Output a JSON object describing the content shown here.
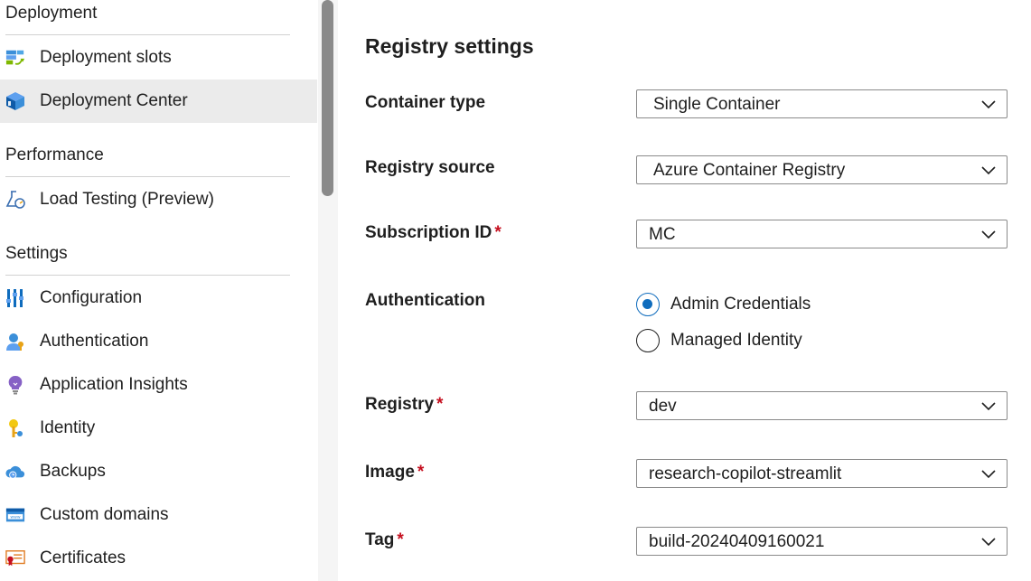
{
  "sidebar": {
    "sections": [
      {
        "title": "Deployment"
      },
      {
        "title": "Performance"
      },
      {
        "title": "Settings"
      }
    ],
    "items": [
      {
        "label": "Deployment slots",
        "icon": "deployment-slots-icon"
      },
      {
        "label": "Deployment Center",
        "icon": "deployment-center-icon",
        "selected": true
      },
      {
        "label": "Load Testing (Preview)",
        "icon": "load-testing-icon"
      },
      {
        "label": "Configuration",
        "icon": "configuration-icon"
      },
      {
        "label": "Authentication",
        "icon": "authentication-icon"
      },
      {
        "label": "Application Insights",
        "icon": "application-insights-icon"
      },
      {
        "label": "Identity",
        "icon": "identity-icon"
      },
      {
        "label": "Backups",
        "icon": "backups-icon"
      },
      {
        "label": "Custom domains",
        "icon": "custom-domains-icon"
      },
      {
        "label": "Certificates",
        "icon": "certificates-icon"
      }
    ]
  },
  "form": {
    "title": "Registry settings",
    "required_marker": "*",
    "container_type": {
      "label": "Container type",
      "value": "Single Container"
    },
    "registry_source": {
      "label": "Registry source",
      "value": "Azure Container Registry"
    },
    "subscription_id": {
      "label": "Subscription ID",
      "value": "MC"
    },
    "authentication": {
      "label": "Authentication",
      "options": [
        {
          "label": "Admin Credentials",
          "checked": true
        },
        {
          "label": "Managed Identity",
          "checked": false
        }
      ]
    },
    "registry": {
      "label": "Registry",
      "value": "dev"
    },
    "image": {
      "label": "Image",
      "value": "research-copilot-streamlit"
    },
    "tag": {
      "label": "Tag",
      "value": "build-20240409160021"
    }
  },
  "colors": {
    "accent": "#0f6cbd",
    "required": "#c50f1f",
    "selected_background": "#ebebeb"
  }
}
